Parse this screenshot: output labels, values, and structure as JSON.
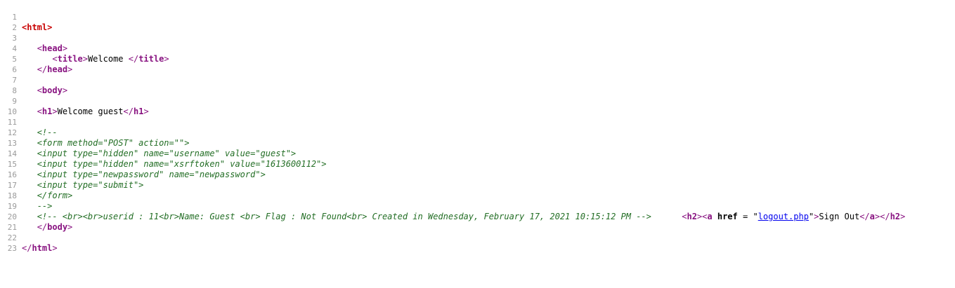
{
  "page_title": "Welcome",
  "source": {
    "line_numbers": [
      "1",
      "2",
      "3",
      "4",
      "5",
      "6",
      "7",
      "8",
      "9",
      "10",
      "11",
      "12",
      "13",
      "14",
      "15",
      "16",
      "17",
      "18",
      "19",
      "20",
      "21",
      "22",
      "23"
    ],
    "html_open": "html",
    "head_open": "head",
    "title_tag": "title",
    "title_text": "Welcome ",
    "head_close": "head",
    "body_open": "body",
    "h1_tag": "h1",
    "h1_text": "Welcome guest",
    "comment_open": "<!--",
    "comment_lines": [
      "<form method=\"POST\" action=\"\">",
      "<input type=\"hidden\" name=\"username\" value=\"guest\">",
      "<input type=\"hidden\" name=\"xsrftoken\" value=\"1613600112\">",
      "<input type=\"newpassword\" name=\"newpassword\">",
      "<input type=\"submit\">",
      "</form>"
    ],
    "comment_close": "-->",
    "info_comment": "<!-- <br><br>userid : 11<br>Name: Guest <br> Flag : Not Found<br> Created in Wednesday, February 17, 2021 10:15:12 PM -->",
    "h2_tag": "h2",
    "a_tag": "a",
    "href_attr": "href",
    "equals": " = ",
    "href_value": "logout.php",
    "link_text": "Sign Out",
    "body_close": "body",
    "html_close": "html"
  }
}
